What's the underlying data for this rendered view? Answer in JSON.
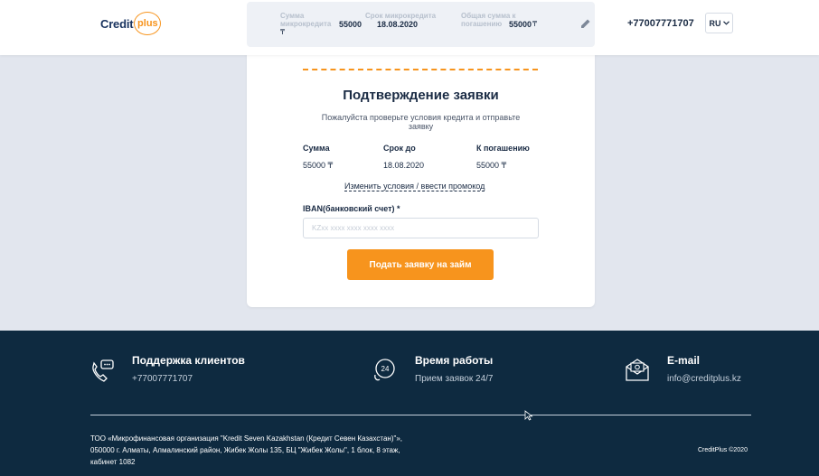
{
  "header": {
    "logo_word": "Credit",
    "logo_circle": "plus",
    "summary": {
      "amount_label": "Сумма микрокредита",
      "amount_value": "55000",
      "currency": "₸",
      "term_label": "Срок микрокредита",
      "term_value": "18.08.2020",
      "total_label": "Общая сумма к погашению",
      "total_value": "55000"
    },
    "phone": "+77007771707",
    "lang": "RU"
  },
  "card": {
    "title": "Подтверждение заявки",
    "subtitle": "Пожалуйста проверьте условия кредита и отправьте заявку",
    "columns": [
      {
        "label": "Сумма",
        "value": "55000 ₸"
      },
      {
        "label": "Срок до",
        "value": "18.08.2020"
      },
      {
        "label": "К погашению",
        "value": "55000 ₸"
      }
    ],
    "change_link": "Изменить условия / ввести промокод",
    "iban_label": "IBAN(банковский счет) *",
    "iban_placeholder": "KZxx xxxx xxxx xxxx xxxx",
    "submit": "Подать заявку на займ"
  },
  "footer": {
    "support_title": "Поддержка клиентов",
    "support_phone": "+77007771707",
    "hours_title": "Время работы",
    "hours_text": "Прием заявок 24/7",
    "email_title": "E-mail",
    "email": "info@creditplus.kz",
    "address_line1": "ТОО «Микрофинансовая организация \"Kredit Seven Kazakhstan (Кредит Севен Казахстан)\"»,",
    "address_line2": "050000 г. Алматы, Алмалинский район, Жибек Жолы 135, БЦ \"Жибек Жолы\", 1 блок, 8 этаж,",
    "address_line3": "кабинет 1082",
    "copyright": "CreditPlus ©2020",
    "clock_icon_text": "24"
  },
  "colors": {
    "accent": "#f7941d",
    "dark": "#1a2b44",
    "footer_bg": "#0e2a40",
    "page_bg": "#e2e6ee"
  }
}
